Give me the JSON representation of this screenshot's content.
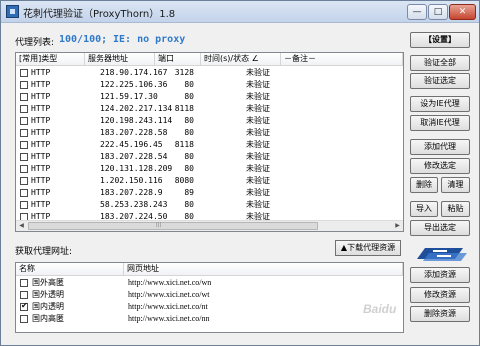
{
  "window": {
    "title": "花刺代理验证（ProxyThorn）1.8",
    "minimize_glyph": "—",
    "maximize_glyph": "□",
    "close_glyph": "✕"
  },
  "proxy_list": {
    "label": "代理列表:",
    "count": "100/100;",
    "ie_status": "IE: no proxy",
    "columns": [
      "[常用]类型",
      "服务器地址",
      "端口",
      "时间(s)/状态 ∠",
      "－备注－"
    ],
    "rows": [
      {
        "type": "HTTP",
        "ip": "218.90.174.167",
        "port": "3128",
        "status": "未验证"
      },
      {
        "type": "HTTP",
        "ip": "122.225.106.36",
        "port": "80",
        "status": "未验证"
      },
      {
        "type": "HTTP",
        "ip": "121.59.17.30",
        "port": "80",
        "status": "未验证"
      },
      {
        "type": "HTTP",
        "ip": "124.202.217.134",
        "port": "8118",
        "status": "未验证"
      },
      {
        "type": "HTTP",
        "ip": "120.198.243.114",
        "port": "80",
        "status": "未验证"
      },
      {
        "type": "HTTP",
        "ip": "183.207.228.58",
        "port": "80",
        "status": "未验证"
      },
      {
        "type": "HTTP",
        "ip": "222.45.196.45",
        "port": "8118",
        "status": "未验证"
      },
      {
        "type": "HTTP",
        "ip": "183.207.228.54",
        "port": "80",
        "status": "未验证"
      },
      {
        "type": "HTTP",
        "ip": "120.131.128.209",
        "port": "80",
        "status": "未验证"
      },
      {
        "type": "HTTP",
        "ip": "1.202.150.116",
        "port": "8080",
        "status": "未验证"
      },
      {
        "type": "HTTP",
        "ip": "183.207.228.9",
        "port": "89",
        "status": "未验证"
      },
      {
        "type": "HTTP",
        "ip": "58.253.238.243",
        "port": "80",
        "status": "未验证"
      },
      {
        "type": "HTTP",
        "ip": "183.207.224.50",
        "port": "80",
        "status": "未验证"
      }
    ],
    "scroll_left": "◀",
    "scroll_right": "▶",
    "scroll_grip": "|||"
  },
  "sources": {
    "label": "获取代理网址:",
    "download_button": "▲下载代理资源",
    "columns": [
      "名称",
      "网页地址"
    ],
    "rows": [
      {
        "name": "国外高匿",
        "url": "http://www.xici.net.co/wn",
        "checked": false
      },
      {
        "name": "国外透明",
        "url": "http://www.xici.net.co/wt",
        "checked": false
      },
      {
        "name": "国内透明",
        "url": "http://www.xici.net.co/nt",
        "checked": true
      },
      {
        "name": "国内高匿",
        "url": "http://www.xici.net.co/nn",
        "checked": false
      }
    ]
  },
  "buttons": {
    "settings": "【设置】",
    "verify_all": "验证全部",
    "verify_selected": "验证选定",
    "set_ie_proxy": "设为IE代理",
    "cancel_ie_proxy": "取消IE代理",
    "add_proxy": "添加代理",
    "edit_selected": "修改选定",
    "delete": "删除",
    "clear": "清理",
    "import": "导入",
    "paste": "粘贴",
    "export_selected": "导出选定",
    "add_resource": "添加资源",
    "edit_resource": "修改资源",
    "delete_resource": "删除资源"
  },
  "watermark": "Baidu",
  "colors": {
    "accent_text": "#2f7ac8",
    "title_gradient_top": "#dbe6f4",
    "close_button": "#c6452f"
  }
}
